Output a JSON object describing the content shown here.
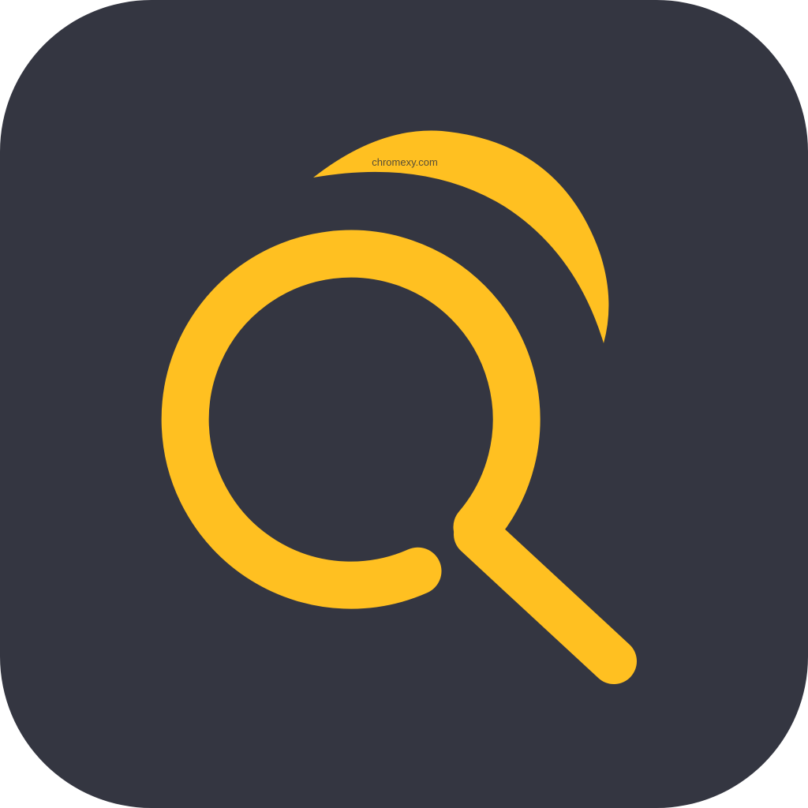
{
  "icon": {
    "name": "search-magnifier-app-icon",
    "background_color": "#343641",
    "accent_color": "#FFC021"
  },
  "watermark": {
    "text": "chromexy.com"
  }
}
